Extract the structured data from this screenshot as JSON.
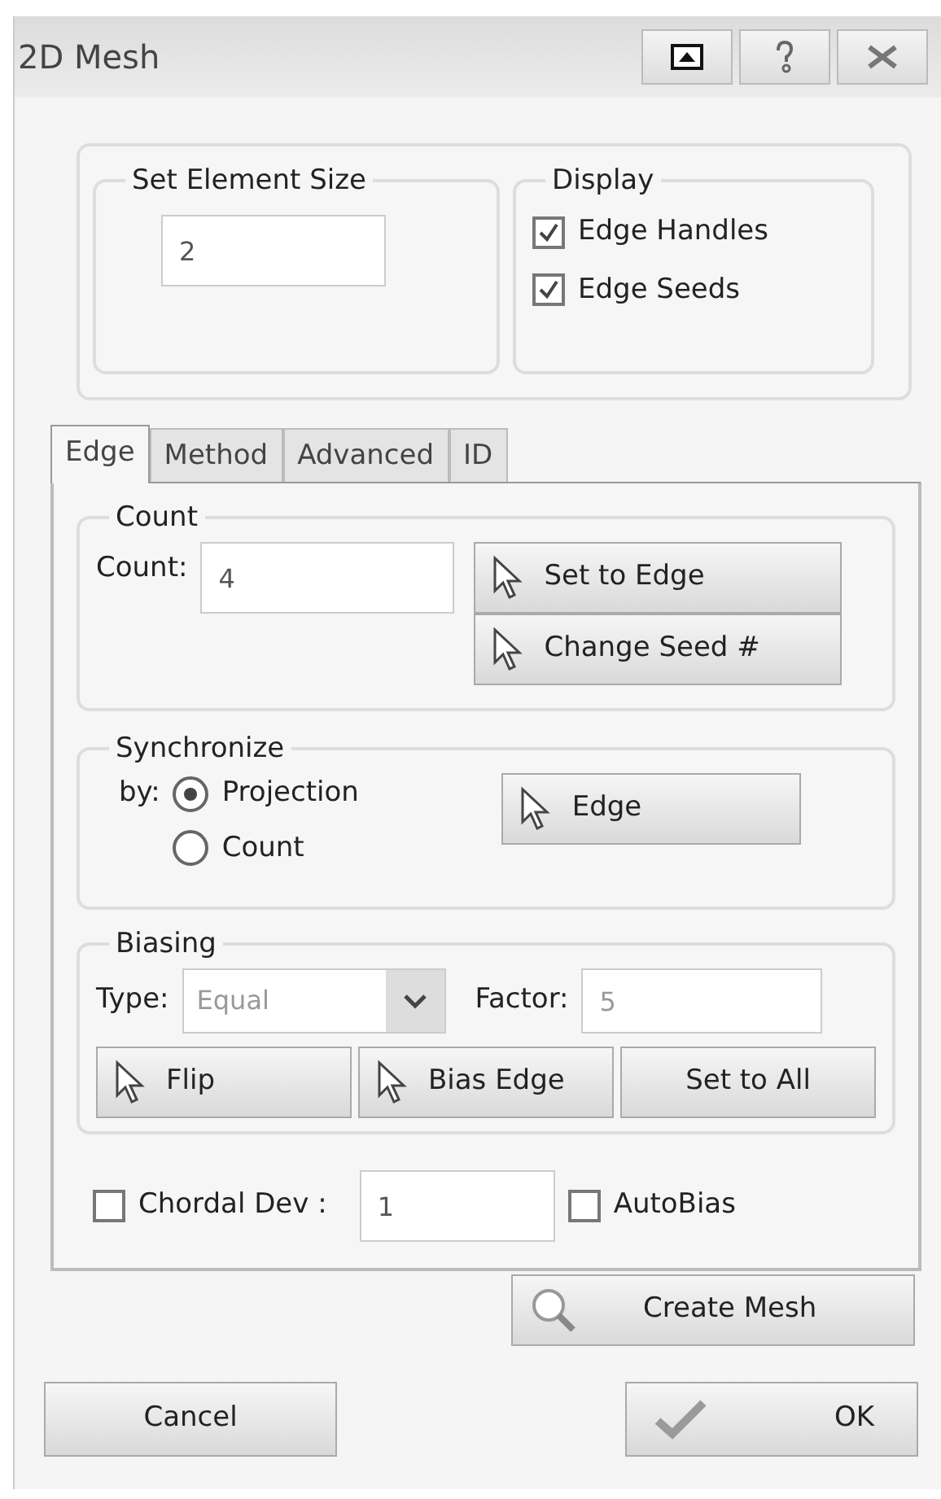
{
  "window": {
    "title": "2D Mesh"
  },
  "element_size": {
    "label": "Set Element Size",
    "value": "2"
  },
  "display": {
    "label": "Display",
    "options": [
      {
        "label": "Edge Handles",
        "checked": true
      },
      {
        "label": "Edge Seeds",
        "checked": true
      }
    ]
  },
  "tabs": [
    {
      "label": "Edge",
      "selected": true
    },
    {
      "label": "Method",
      "selected": false
    },
    {
      "label": "Advanced",
      "selected": false
    },
    {
      "label": "ID",
      "selected": false
    }
  ],
  "count_group": {
    "label": "Count",
    "field_label": "Count:",
    "value": "4",
    "buttons": [
      "Set to Edge",
      "Change Seed #"
    ]
  },
  "synchronize": {
    "label": "Synchronize",
    "by_label": "by:",
    "options": [
      {
        "label": "Projection",
        "selected": true
      },
      {
        "label": "Count",
        "selected": false
      }
    ],
    "button": "Edge"
  },
  "biasing": {
    "label": "Biasing",
    "type_label": "Type:",
    "type_value": "Equal",
    "factor_label": "Factor:",
    "factor_value": "5",
    "buttons": [
      {
        "label": "Flip",
        "kind": "pick"
      },
      {
        "label": "Bias Edge",
        "kind": "pick"
      },
      {
        "label": "Set to All",
        "kind": "plain"
      }
    ]
  },
  "chordal": {
    "label": "Chordal Dev :",
    "checked": false,
    "value": "1"
  },
  "autobias": {
    "label": "AutoBias",
    "checked": false
  },
  "create_button": "Create Mesh",
  "footer_buttons": [
    {
      "label": "Cancel",
      "kind": "plain"
    },
    {
      "label": "OK",
      "kind": "confirm"
    }
  ]
}
